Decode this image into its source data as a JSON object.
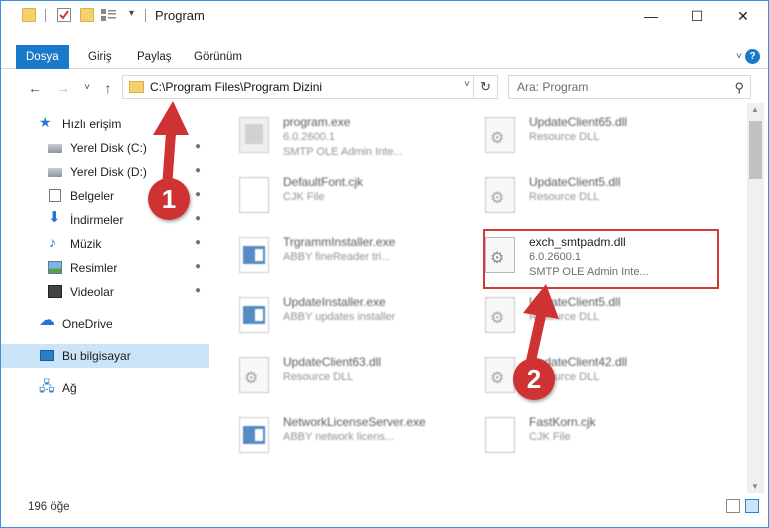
{
  "window": {
    "title": "Program",
    "minimize_glyph": "—",
    "maximize_glyph": "☐",
    "close_glyph": "✕"
  },
  "quick_access_toolbar": {
    "dropdown_glyph": "▾"
  },
  "ribbon": {
    "tabs": [
      "Dosya",
      "Giriş",
      "Paylaş",
      "Görünüm"
    ],
    "active_tab": "Dosya",
    "expand_glyph": "˅",
    "help_glyph": "?"
  },
  "navigation": {
    "back_glyph": "←",
    "forward_glyph": "→",
    "recent_glyph": "˅",
    "up_glyph": "↑",
    "address": "C:\\Program Files\\Program Dizini",
    "address_dropdown_glyph": "˅",
    "refresh_glyph": "↻",
    "search_placeholder": "Ara: Program",
    "search_glyph": "⚲"
  },
  "sidebar": {
    "pin_glyph": "📌",
    "items": [
      {
        "label": "Hızlı erişim",
        "icon": "star-icon",
        "pinned": false
      },
      {
        "label": "Yerel Disk (C:)",
        "icon": "drive-icon",
        "pinned": true
      },
      {
        "label": "Yerel Disk (D:)",
        "icon": "drive-icon",
        "pinned": true
      },
      {
        "label": "Belgeler",
        "icon": "documents-icon",
        "pinned": true
      },
      {
        "label": "İndirmeler",
        "icon": "downloads-icon",
        "pinned": true
      },
      {
        "label": "Müzik",
        "icon": "music-icon",
        "pinned": true
      },
      {
        "label": "Resimler",
        "icon": "pictures-icon",
        "pinned": true
      },
      {
        "label": "Videolar",
        "icon": "videos-icon",
        "pinned": true
      },
      {
        "label": "OneDrive",
        "icon": "onedrive-icon",
        "pinned": false
      },
      {
        "label": "Bu bilgisayar",
        "icon": "this-pc-icon",
        "pinned": false,
        "selected": true
      },
      {
        "label": "Ağ",
        "icon": "network-icon",
        "pinned": false
      }
    ]
  },
  "files": [
    {
      "name": "program.exe",
      "line2": "6.0.2600.1",
      "line3": "SMTP OLE Admin Inte...",
      "icon": "exe-icon",
      "blurred": true
    },
    {
      "name": "UpdateClient65.dll",
      "line2": "Resource DLL",
      "line3": "",
      "icon": "dll-icon",
      "blurred": true
    },
    {
      "name": "DefaultFont.cjk",
      "line2": "CJK File",
      "line3": "",
      "icon": "page-icon",
      "blurred": true
    },
    {
      "name": "UpdateClient5.dll",
      "line2": "Resource DLL",
      "line3": "",
      "icon": "dll-icon",
      "blurred": true
    },
    {
      "name": "TrgrammInstaller.exe",
      "line2": "ABBY fineReader tri...",
      "line3": "",
      "icon": "app-icon",
      "blurred": true
    },
    {
      "name": "exch_smtpadm.dll",
      "line2": "6.0.2600.1",
      "line3": "SMTP OLE Admin Inte...",
      "icon": "dll-icon",
      "blurred": false,
      "highlighted": true
    },
    {
      "name": "UpdateInstaller.exe",
      "line2": "ABBY updates installer",
      "line3": "",
      "icon": "app-icon",
      "blurred": true
    },
    {
      "name": "UpdateClient5.dll",
      "line2": "Resource DLL",
      "line3": "",
      "icon": "dll-icon",
      "blurred": true
    },
    {
      "name": "UpdateClient63.dll",
      "line2": "Resource DLL",
      "line3": "",
      "icon": "dll-icon",
      "blurred": true
    },
    {
      "name": "UpdateClient42.dll",
      "line2": "Resource DLL",
      "line3": "",
      "icon": "dll-icon",
      "blurred": true
    },
    {
      "name": "NetworkLicenseServer.exe",
      "line2": "ABBY network licens...",
      "line3": "",
      "icon": "app-icon",
      "blurred": true
    },
    {
      "name": "FastKorn.cjk",
      "line2": "CJK File",
      "line3": "",
      "icon": "page-icon",
      "blurred": true
    }
  ],
  "status": {
    "item_count": "196 öğe"
  },
  "annotations": [
    {
      "label": "1",
      "color": "#cf3232"
    },
    {
      "label": "2",
      "color": "#cf3232"
    }
  ]
}
